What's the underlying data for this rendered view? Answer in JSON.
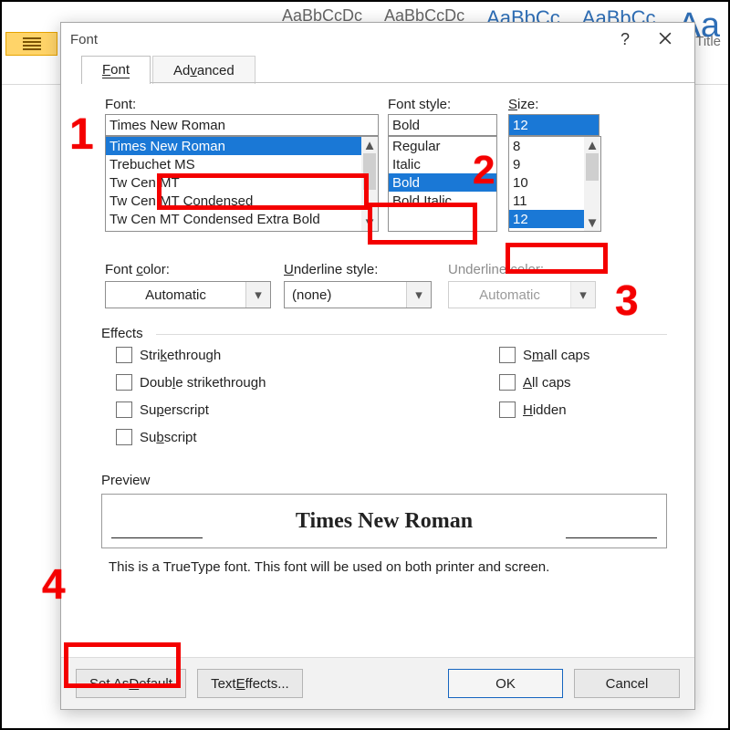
{
  "ribbon": {
    "styles": [
      "AaBbCcDc",
      "AaBbCcDc",
      "AaBbCc",
      "AaBbCc",
      "Aa"
    ],
    "title_label": "Title"
  },
  "dialog": {
    "title": "Font",
    "help": "?",
    "tabs": {
      "font": "Font",
      "advanced": "Advanced"
    },
    "font_label": "Font:",
    "font_value": "Times New Roman",
    "font_list": [
      "Times New Roman",
      "Trebuchet MS",
      "Tw Cen MT",
      "Tw Cen MT Condensed",
      "Tw Cen MT Condensed Extra Bold"
    ],
    "font_selected_index": 0,
    "style_label": "Font style:",
    "style_value": "Bold",
    "style_list": [
      "Regular",
      "Italic",
      "Bold",
      "Bold Italic"
    ],
    "style_selected_index": 2,
    "size_label": "Size:",
    "size_value": "12",
    "size_list": [
      "8",
      "9",
      "10",
      "11",
      "12"
    ],
    "size_selected_index": 4,
    "font_color_label": "Font color:",
    "font_color_value": "Automatic",
    "underline_style_label": "Underline style:",
    "underline_style_value": "(none)",
    "underline_color_label": "Underline color:",
    "underline_color_value": "Automatic",
    "effects_title": "Effects",
    "effects_left": [
      "Strikethrough",
      "Double strikethrough",
      "Superscript",
      "Subscript"
    ],
    "effects_right": [
      "Small caps",
      "All caps",
      "Hidden"
    ],
    "preview_title": "Preview",
    "preview_text": "Times New Roman",
    "description": "This is a TrueType font. This font will be used on both printer and screen.",
    "buttons": {
      "set_default": "Set As Default",
      "text_effects": "Text Effects...",
      "ok": "OK",
      "cancel": "Cancel"
    }
  },
  "annotations": {
    "a1": "1",
    "a2": "2",
    "a3": "3",
    "a4": "4"
  }
}
